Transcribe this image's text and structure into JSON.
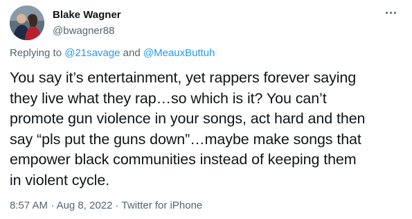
{
  "author": {
    "display_name": "Blake Wagner",
    "handle": "@bwagner88"
  },
  "reply": {
    "prefix": "Replying to ",
    "mention1": "@21savage",
    "connector": " and ",
    "mention2": "@MeauxButtuh"
  },
  "tweet": {
    "lines": [
      "You say it’s entertainment, yet rappers forever saying",
      "they live what they rap…so which is it? You can’t",
      "promote gun violence in your songs, act hard and then",
      "say “pls put the guns down”…maybe make songs that",
      "empower black communities instead of keeping them",
      "in violent cycle."
    ]
  },
  "meta": {
    "time": "8:57 AM",
    "separator": " · ",
    "date": "Aug 8, 2022",
    "source": "Twitter for iPhone"
  },
  "icons": {
    "more": "more-horizontal-icon"
  },
  "colors": {
    "text": "#0f1419",
    "secondary": "#536471",
    "link": "#1d9bf0"
  }
}
